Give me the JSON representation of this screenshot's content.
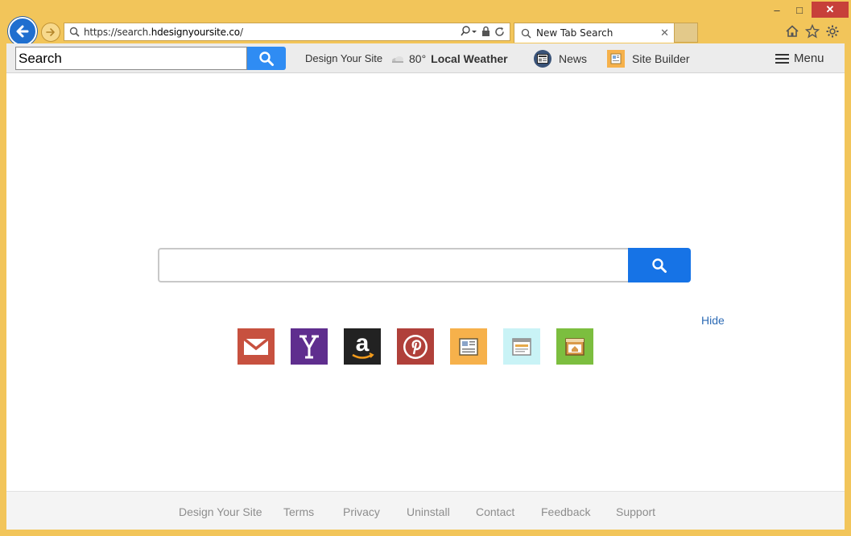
{
  "browser": {
    "url_prefix": "https://search.",
    "url_domain": "hdesignyoursite.co",
    "url_suffix": "/",
    "tab_title": "New Tab Search",
    "caption": {
      "minimize": "–",
      "maximize": "□",
      "close": "✕"
    }
  },
  "toolbar": {
    "search_value": "Search",
    "brand_label": "Design Your Site",
    "weather_temp": "80°",
    "weather_label": "Local Weather",
    "news_label": "News",
    "site_builder_label": "Site Builder",
    "menu_label": "Menu"
  },
  "main": {
    "search_value": "",
    "hide_label": "Hide",
    "shortcuts": [
      {
        "name": "gmail",
        "color": "#c7513f"
      },
      {
        "name": "yahoo",
        "color": "#5f2e8e"
      },
      {
        "name": "amazon",
        "color": "#222222"
      },
      {
        "name": "pinterest",
        "color": "#b0403a"
      },
      {
        "name": "news-app",
        "color": "#f6b14b"
      },
      {
        "name": "web-app",
        "color": "#c9f3f6"
      },
      {
        "name": "home-app",
        "color": "#7cbe3f"
      }
    ]
  },
  "footer": {
    "links": [
      "Design Your Site",
      "Terms",
      "Privacy",
      "Uninstall",
      "Contact",
      "Feedback",
      "Support"
    ]
  }
}
